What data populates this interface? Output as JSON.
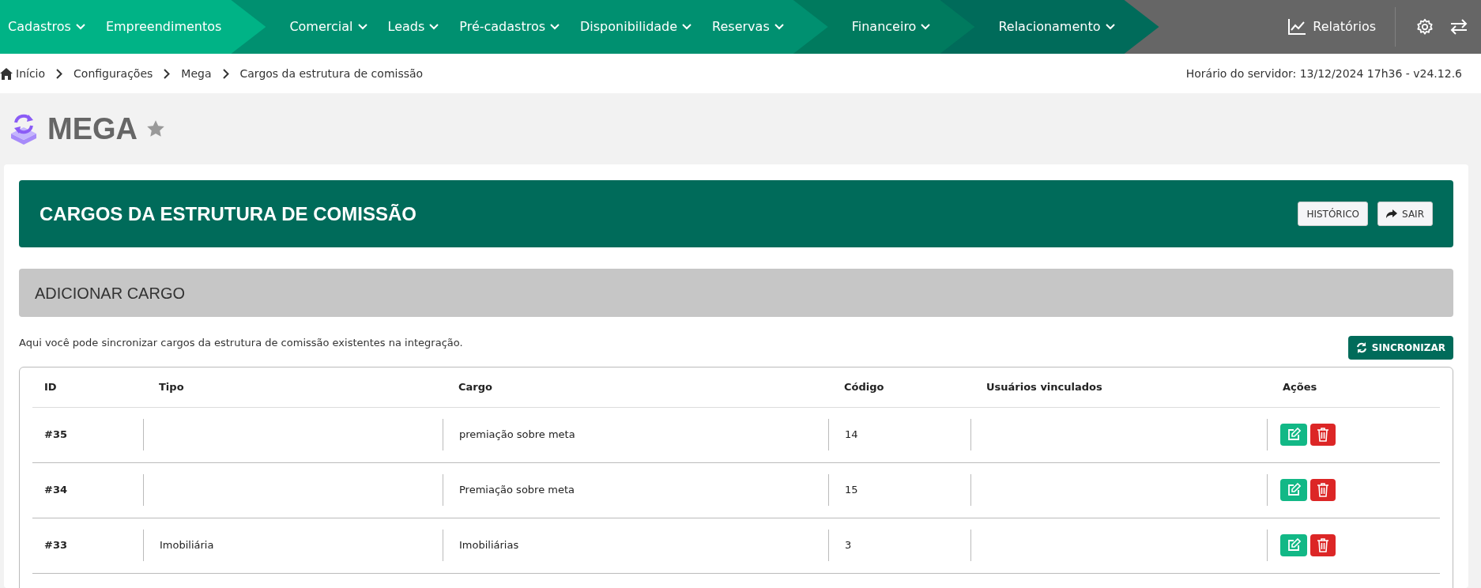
{
  "nav": {
    "groups": [
      {
        "items": [
          {
            "label": "Cadastros",
            "dropdown": true
          },
          {
            "label": "Empreendimentos",
            "dropdown": false
          }
        ]
      },
      {
        "items": [
          {
            "label": "Comercial",
            "dropdown": true
          },
          {
            "label": "Leads",
            "dropdown": true
          },
          {
            "label": "Pré-cadastros",
            "dropdown": true
          },
          {
            "label": "Disponibilidade",
            "dropdown": true
          },
          {
            "label": "Reservas",
            "dropdown": true
          }
        ]
      },
      {
        "items": [
          {
            "label": "Financeiro",
            "dropdown": true
          }
        ]
      },
      {
        "items": [
          {
            "label": "Relacionamento",
            "dropdown": true
          }
        ]
      }
    ],
    "reports": "Relatórios"
  },
  "breadcrumbs": [
    "Início",
    "Configurações",
    "Mega",
    "Cargos da estrutura de comissão"
  ],
  "server_time": "Horário do servidor: 13/12/2024 17h36 - v24.12.6",
  "page_title": "MEGA",
  "favorite": false,
  "header": {
    "title": "CARGOS DA ESTRUTURA DE COMISSÃO",
    "buttons": [
      {
        "label": "HISTÓRICO",
        "kind": "plain"
      },
      {
        "label": "SAIR",
        "kind": "exit"
      }
    ]
  },
  "add_section": "ADICIONAR CARGO",
  "description": "Aqui você pode sincronizar cargos da estrutura de comissão existentes na integração.",
  "sync_button": "SINCRONIZAR",
  "table": {
    "columns": [
      "ID",
      "Tipo",
      "Cargo",
      "Código",
      "Usuários vinculados",
      "Ações"
    ],
    "rows": [
      {
        "id": "#35",
        "tipo": "",
        "cargo": "premiação sobre meta",
        "codigo": "14",
        "usuarios": ""
      },
      {
        "id": "#34",
        "tipo": "",
        "cargo": "Premiação sobre meta",
        "codigo": "15",
        "usuarios": ""
      },
      {
        "id": "#33",
        "tipo": "Imobiliária",
        "cargo": "Imobiliárias",
        "codigo": "3",
        "usuarios": ""
      }
    ]
  }
}
